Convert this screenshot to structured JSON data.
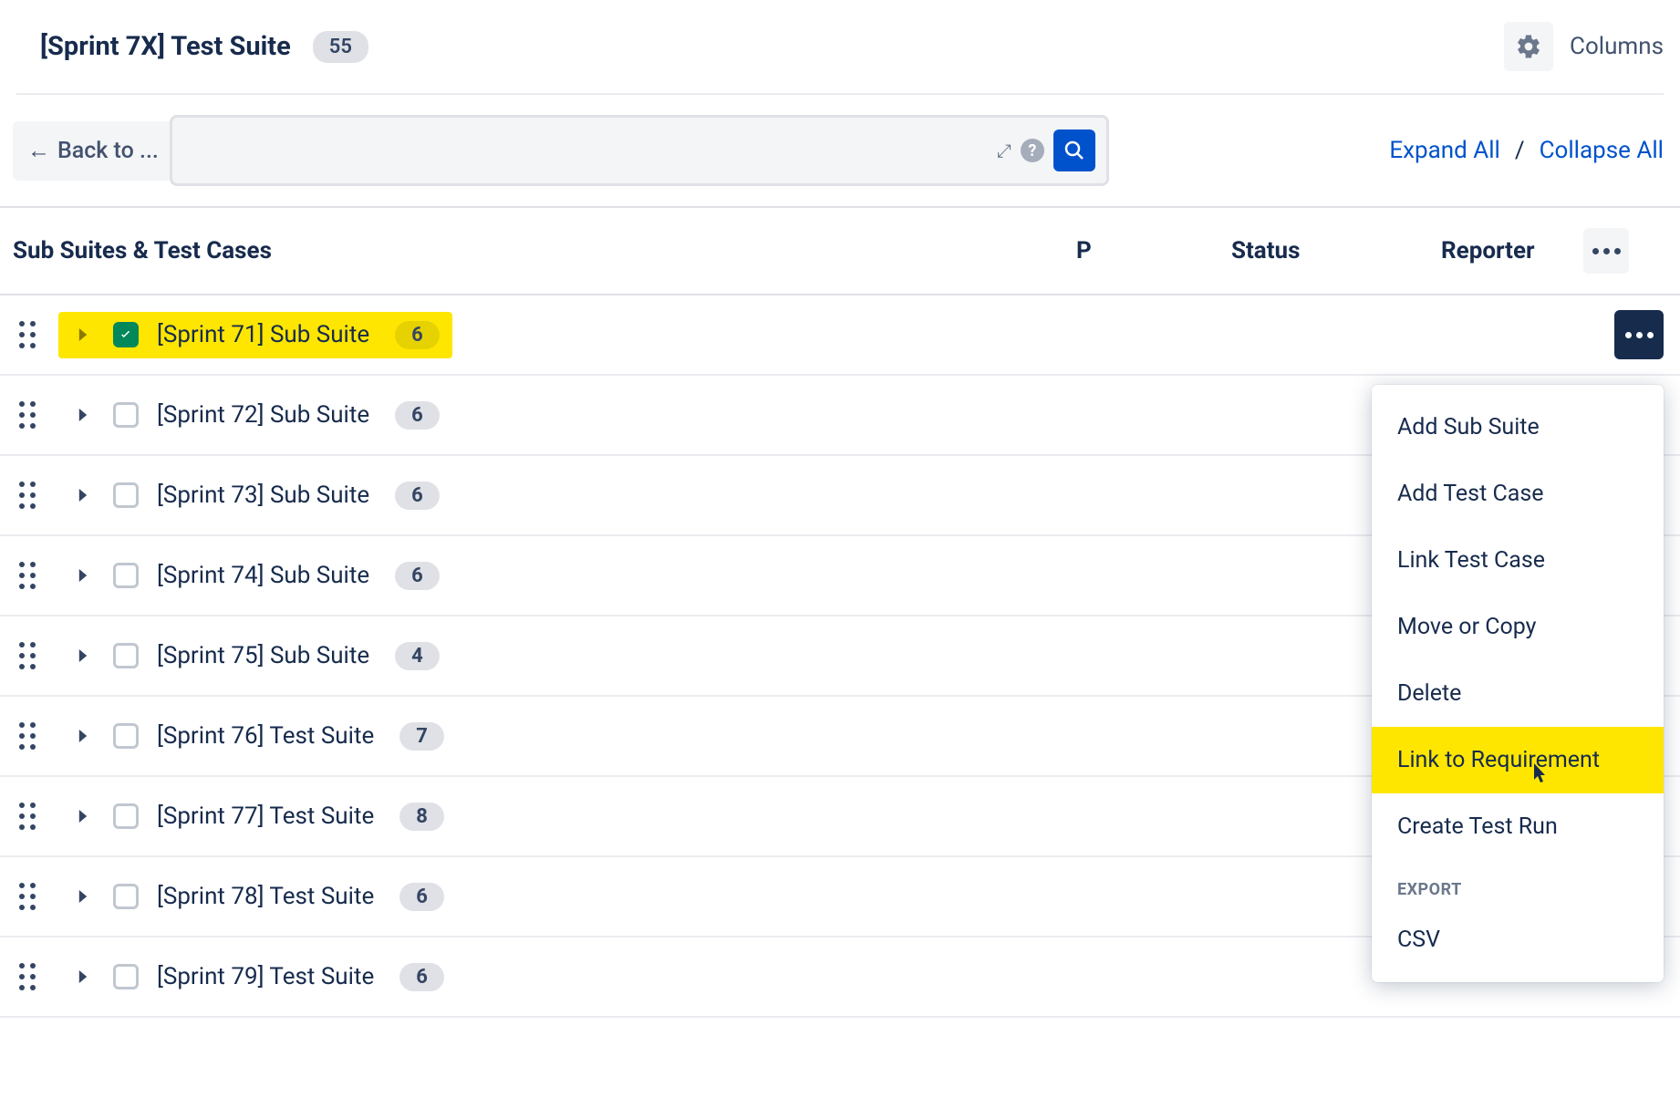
{
  "header": {
    "title": "[Sprint 7X] Test Suite",
    "count": "55",
    "columns_label": "Columns"
  },
  "toolbar": {
    "back_label": "Back to ...",
    "expand_all": "Expand All",
    "collapse_all": "Collapse All",
    "separator": "/"
  },
  "table": {
    "col_main": "Sub Suites & Test Cases",
    "col_p": "P",
    "col_status": "Status",
    "col_reporter": "Reporter"
  },
  "rows": [
    {
      "name": "[Sprint 71] Sub Suite",
      "count": "6",
      "checked": true,
      "highlight": true,
      "show_more": true
    },
    {
      "name": "[Sprint 72] Sub Suite",
      "count": "6",
      "checked": false,
      "highlight": false
    },
    {
      "name": "[Sprint 73] Sub Suite",
      "count": "6",
      "checked": false,
      "highlight": false
    },
    {
      "name": "[Sprint 74] Sub Suite",
      "count": "6",
      "checked": false,
      "highlight": false
    },
    {
      "name": "[Sprint 75] Sub Suite",
      "count": "4",
      "checked": false,
      "highlight": false
    },
    {
      "name": "[Sprint 76] Test Suite",
      "count": "7",
      "checked": false,
      "highlight": false
    },
    {
      "name": "[Sprint 77] Test Suite",
      "count": "8",
      "checked": false,
      "highlight": false
    },
    {
      "name": "[Sprint 78] Test Suite",
      "count": "6",
      "checked": false,
      "highlight": false
    },
    {
      "name": "[Sprint 79] Test Suite",
      "count": "6",
      "checked": false,
      "highlight": false
    }
  ],
  "menu": {
    "items": [
      {
        "label": "Add Sub Suite"
      },
      {
        "label": "Add Test Case"
      },
      {
        "label": "Link Test Case"
      },
      {
        "label": "Move or Copy"
      },
      {
        "label": "Delete"
      },
      {
        "label": "Link to Requirement",
        "highlighted": true
      },
      {
        "label": "Create Test Run"
      }
    ],
    "export_section": "EXPORT",
    "export_items": [
      {
        "label": "CSV"
      }
    ]
  }
}
